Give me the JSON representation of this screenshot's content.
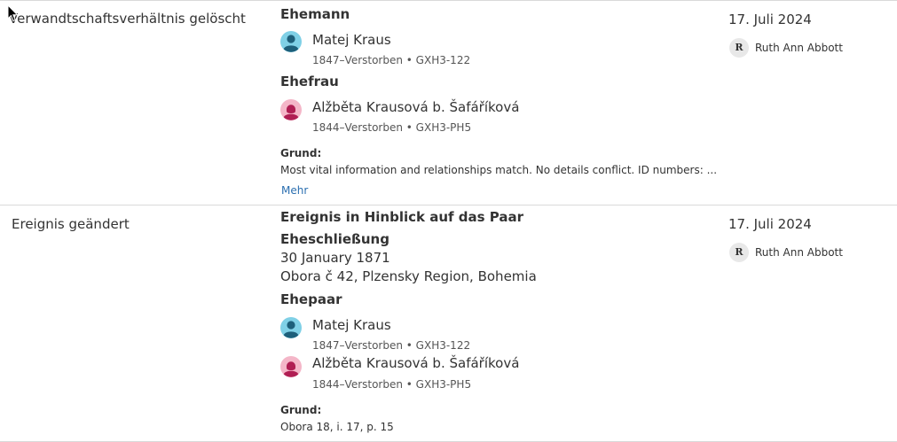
{
  "cursor_icon": "arrow-cursor-icon",
  "entries": [
    {
      "type": "Verwandtschaftsverhältnis gelöscht",
      "date": "17. Juli 2024",
      "user": {
        "initial": "R",
        "name": "Ruth Ann Abbott"
      },
      "husband_heading": "Ehemann",
      "husband": {
        "name": "Matej Kraus",
        "meta": "1847–Verstorben • GXH3-122",
        "gender": "male"
      },
      "wife_heading": "Ehefrau",
      "wife": {
        "name": "Alžběta Krausová b. Šafáříková",
        "meta": "1844–Verstorben • GXH3-PH5",
        "gender": "female"
      },
      "reason_label": "Grund:",
      "reason": "Most vital information and relationships match. No details conflict. ID numbers: ...",
      "more_link": "Mehr"
    },
    {
      "type": "Ereignis geändert",
      "date": "17. Juli 2024",
      "user": {
        "initial": "R",
        "name": "Ruth Ann Abbott"
      },
      "event_heading": "Ereignis in Hinblick auf das Paar",
      "event_name": "Eheschließung",
      "event_date": "30 January 1871",
      "event_place": "Obora č 42, Plzensky Region, Bohemia",
      "couple_heading": "Ehepaar",
      "husband": {
        "name": "Matej Kraus",
        "meta": "1847–Verstorben • GXH3-122",
        "gender": "male"
      },
      "wife": {
        "name": "Alžběta Krausová b. Šafáříková",
        "meta": "1844–Verstorben • GXH3-PH5",
        "gender": "female"
      },
      "reason_label": "Grund:",
      "reason": "Obora 18, i. 17, p. 15"
    }
  ],
  "colors": {
    "male_avatar_bg": "#7fd0e6",
    "male_avatar_fg": "#1d5f7a",
    "female_avatar_bg": "#f4b6c8",
    "female_avatar_fg": "#b01e53",
    "link": "#2b6fb0",
    "divider": "#d9d9d9"
  }
}
